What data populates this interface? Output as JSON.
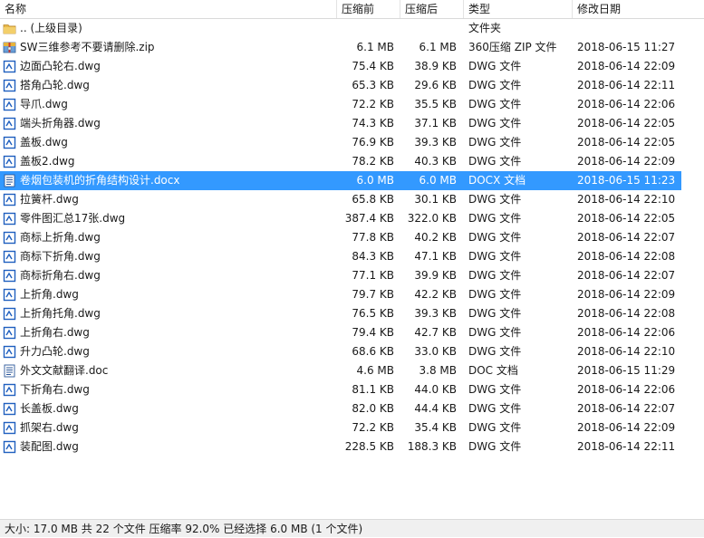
{
  "columns": {
    "name": "名称",
    "compressed": "压缩前",
    "original": "压缩后",
    "type": "类型",
    "modified": "修改日期"
  },
  "files": [
    {
      "icon": "folder-icon",
      "name": ".. (上级目录)",
      "compressed": "",
      "original": "",
      "type": "文件夹",
      "modified": ""
    },
    {
      "icon": "zip-archive-icon",
      "name": "SW三维参考不要请删除.zip",
      "compressed": "6.1 MB",
      "original": "6.1 MB",
      "type": "360压缩 ZIP 文件",
      "modified": "2018-06-15 11:27"
    },
    {
      "icon": "dwg-file-icon",
      "name": "边面凸轮右.dwg",
      "compressed": "75.4 KB",
      "original": "38.9 KB",
      "type": "DWG 文件",
      "modified": "2018-06-14 22:09"
    },
    {
      "icon": "dwg-file-icon",
      "name": "搭角凸轮.dwg",
      "compressed": "65.3 KB",
      "original": "29.6 KB",
      "type": "DWG 文件",
      "modified": "2018-06-14 22:11"
    },
    {
      "icon": "dwg-file-icon",
      "name": "导爪.dwg",
      "compressed": "72.2 KB",
      "original": "35.5 KB",
      "type": "DWG 文件",
      "modified": "2018-06-14 22:06"
    },
    {
      "icon": "dwg-file-icon",
      "name": "端头折角器.dwg",
      "compressed": "74.3 KB",
      "original": "37.1 KB",
      "type": "DWG 文件",
      "modified": "2018-06-14 22:05"
    },
    {
      "icon": "dwg-file-icon",
      "name": "盖板.dwg",
      "compressed": "76.9 KB",
      "original": "39.3 KB",
      "type": "DWG 文件",
      "modified": "2018-06-14 22:05"
    },
    {
      "icon": "dwg-file-icon",
      "name": "盖板2.dwg",
      "compressed": "78.2 KB",
      "original": "40.3 KB",
      "type": "DWG 文件",
      "modified": "2018-06-14 22:09"
    },
    {
      "icon": "docx-file-icon",
      "name": "卷烟包装机的折角结构设计.docx",
      "compressed": "6.0 MB",
      "original": "6.0 MB",
      "type": "DOCX 文档",
      "modified": "2018-06-15 11:23",
      "selected": true
    },
    {
      "icon": "dwg-file-icon",
      "name": "拉簧杆.dwg",
      "compressed": "65.8 KB",
      "original": "30.1 KB",
      "type": "DWG 文件",
      "modified": "2018-06-14 22:10"
    },
    {
      "icon": "dwg-file-icon",
      "name": "零件图汇总17张.dwg",
      "compressed": "387.4 KB",
      "original": "322.0 KB",
      "type": "DWG 文件",
      "modified": "2018-06-14 22:05"
    },
    {
      "icon": "dwg-file-icon",
      "name": "商标上折角.dwg",
      "compressed": "77.8 KB",
      "original": "40.2 KB",
      "type": "DWG 文件",
      "modified": "2018-06-14 22:07"
    },
    {
      "icon": "dwg-file-icon",
      "name": "商标下折角.dwg",
      "compressed": "84.3 KB",
      "original": "47.1 KB",
      "type": "DWG 文件",
      "modified": "2018-06-14 22:08"
    },
    {
      "icon": "dwg-file-icon",
      "name": "商标折角右.dwg",
      "compressed": "77.1 KB",
      "original": "39.9 KB",
      "type": "DWG 文件",
      "modified": "2018-06-14 22:07"
    },
    {
      "icon": "dwg-file-icon",
      "name": "上折角.dwg",
      "compressed": "79.7 KB",
      "original": "42.2 KB",
      "type": "DWG 文件",
      "modified": "2018-06-14 22:09"
    },
    {
      "icon": "dwg-file-icon",
      "name": "上折角托角.dwg",
      "compressed": "76.5 KB",
      "original": "39.3 KB",
      "type": "DWG 文件",
      "modified": "2018-06-14 22:08"
    },
    {
      "icon": "dwg-file-icon",
      "name": "上折角右.dwg",
      "compressed": "79.4 KB",
      "original": "42.7 KB",
      "type": "DWG 文件",
      "modified": "2018-06-14 22:06"
    },
    {
      "icon": "dwg-file-icon",
      "name": "升力凸轮.dwg",
      "compressed": "68.6 KB",
      "original": "33.0 KB",
      "type": "DWG 文件",
      "modified": "2018-06-14 22:10"
    },
    {
      "icon": "doc-file-icon",
      "name": "外文文献翻译.doc",
      "compressed": "4.6 MB",
      "original": "3.8 MB",
      "type": "DOC 文档",
      "modified": "2018-06-15 11:29"
    },
    {
      "icon": "dwg-file-icon",
      "name": "下折角右.dwg",
      "compressed": "81.1 KB",
      "original": "44.0 KB",
      "type": "DWG 文件",
      "modified": "2018-06-14 22:06"
    },
    {
      "icon": "dwg-file-icon",
      "name": "长盖板.dwg",
      "compressed": "82.0 KB",
      "original": "44.4 KB",
      "type": "DWG 文件",
      "modified": "2018-06-14 22:07"
    },
    {
      "icon": "dwg-file-icon",
      "name": "抓架右.dwg",
      "compressed": "72.2 KB",
      "original": "35.4 KB",
      "type": "DWG 文件",
      "modified": "2018-06-14 22:09"
    },
    {
      "icon": "dwg-file-icon",
      "name": "装配图.dwg",
      "compressed": "228.5 KB",
      "original": "188.3 KB",
      "type": "DWG 文件",
      "modified": "2018-06-14 22:11"
    }
  ],
  "status_bar": {
    "text": "大小: 17.0 MB 共 22 个文件 压缩率 92.0% 已经选择 6.0 MB (1 个文件)"
  },
  "colors": {
    "selection": "#3399ff",
    "dwg_icon_blue": "#1f5fbf",
    "folder_yellow": "#e8b84a",
    "status_bg": "#f0f0f0"
  }
}
